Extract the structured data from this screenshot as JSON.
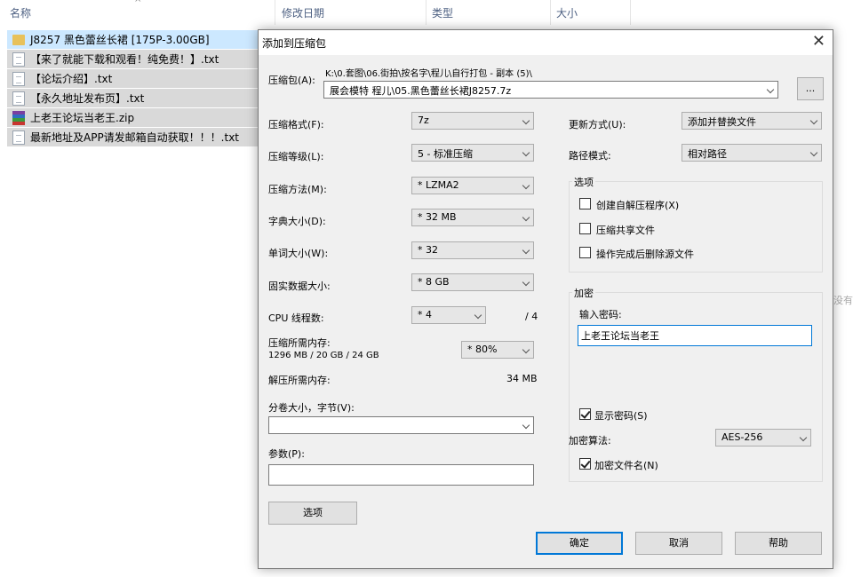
{
  "explorer": {
    "columns": [
      "名称",
      "修改日期",
      "类型",
      "大小"
    ],
    "files": [
      {
        "icon": "folder-icon",
        "name": "J8257 黑色蕾丝长裙 [175P-3.00GB]",
        "selected": true
      },
      {
        "icon": "text-file-icon",
        "name": "【来了就能下载和观看！纯免费！】.txt"
      },
      {
        "icon": "text-file-icon",
        "name": "【论坛介绍】.txt"
      },
      {
        "icon": "text-file-icon",
        "name": "【永久地址发布页】.txt"
      },
      {
        "icon": "rar-archive-icon",
        "name": "上老王论坛当老王.zip"
      },
      {
        "icon": "text-file-icon",
        "name": "最新地址及APP请发邮箱自动获取！！！.txt"
      }
    ],
    "edge_text": "没有"
  },
  "dialog": {
    "title": "添加到压缩包",
    "archive_label": "压缩包(A):",
    "archive_path": "K:\\0.套图\\06.街拍\\按名字\\程儿\\自行打包 - 副本 (5)\\",
    "archive_name": "展会模特 程儿\\05.黑色蕾丝长裙J8257.7z",
    "browse_label": "...",
    "format_label": "压缩格式(F):",
    "format_value": "7z",
    "level_label": "压缩等级(L):",
    "level_value": "5 - 标准压缩",
    "method_label": "压缩方法(M):",
    "method_value": "* LZMA2",
    "dict_label": "字典大小(D):",
    "dict_value": "* 32 MB",
    "word_label": "单词大小(W):",
    "word_value": "* 32",
    "solid_label": "固实数据大小:",
    "solid_value": "* 8 GB",
    "threads_label": "CPU 线程数:",
    "threads_value": "* 4",
    "threads_max": "/ 4",
    "mem_comp_label": "压缩所需内存:",
    "mem_comp_value": "1296 MB / 20 GB / 24 GB",
    "mem_percent": "* 80%",
    "mem_decomp_label": "解压所需内存:",
    "mem_decomp_value": "34 MB",
    "volume_label": "分卷大小，字节(V):",
    "volume_value": "",
    "params_label": "参数(P):",
    "params_value": "",
    "options_button": "选项",
    "update_label": "更新方式(U):",
    "update_value": "添加并替换文件",
    "path_label": "路径模式:",
    "path_value": "相对路径",
    "options_group": "选项",
    "opt_sfx": "创建自解压程序(X)",
    "opt_shared": "压缩共享文件",
    "opt_delete": "操作完成后删除源文件",
    "encrypt_group": "加密",
    "password_label": "输入密码:",
    "password_value": "上老王论坛当老王",
    "show_password": "显示密码(S)",
    "encrypt_method_label": "加密算法:",
    "encrypt_method_value": "AES-256",
    "encrypt_names": "加密文件名(N)",
    "ok": "确定",
    "cancel": "取消",
    "help": "帮助"
  }
}
